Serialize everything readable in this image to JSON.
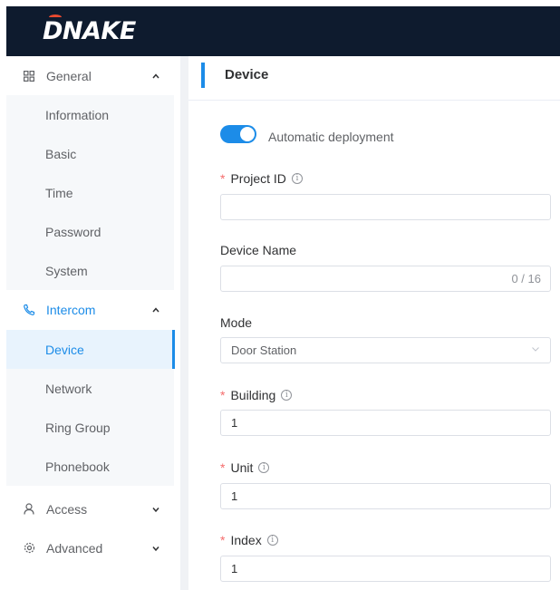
{
  "header": {
    "logo_text": "DNAKE",
    "bg_color": "#0e1b2e",
    "accent_color": "#e8492f"
  },
  "sidebar": {
    "groups": [
      {
        "label": "General",
        "icon": "grid-icon",
        "expanded": true,
        "items": [
          "Information",
          "Basic",
          "Time",
          "Password",
          "System"
        ]
      },
      {
        "label": "Intercom",
        "icon": "phone-icon",
        "expanded": true,
        "active": true,
        "items": [
          "Device",
          "Network",
          "Ring Group",
          "Phonebook"
        ],
        "active_item": "Device"
      },
      {
        "label": "Access",
        "icon": "user-icon",
        "expanded": false
      },
      {
        "label": "Advanced",
        "icon": "gear-icon",
        "expanded": false
      }
    ]
  },
  "main": {
    "title": "Device",
    "auto_deploy": {
      "label": "Automatic deployment",
      "on": true
    },
    "fields": {
      "project_id": {
        "label": "Project ID",
        "required": true,
        "value": ""
      },
      "device_name": {
        "label": "Device Name",
        "required": false,
        "value": "",
        "counter": "0 / 16"
      },
      "mode": {
        "label": "Mode",
        "value": "Door Station"
      },
      "building": {
        "label": "Building",
        "required": true,
        "value": "1"
      },
      "unit": {
        "label": "Unit",
        "required": true,
        "value": "1"
      },
      "index": {
        "label": "Index",
        "required": true,
        "value": "1"
      }
    }
  },
  "colors": {
    "accent": "#1c8ce8",
    "required": "#f56c6c",
    "active_bg": "#e8f3fd"
  }
}
